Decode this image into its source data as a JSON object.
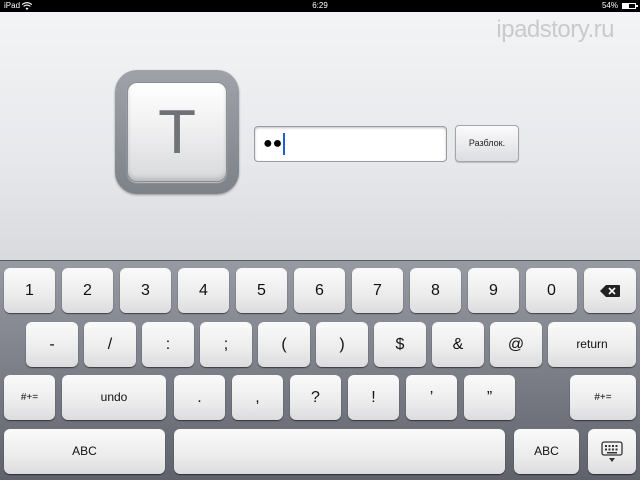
{
  "status_bar": {
    "carrier": "iPad",
    "time": "6:29",
    "battery_percent": "54%",
    "battery_level": 0.54
  },
  "watermark": "ipadstory.ru",
  "app_icon": {
    "letter": "T",
    "icon": "text-app-icon"
  },
  "password_field": {
    "value": "●●"
  },
  "unlock_button": {
    "label": "Разблок."
  },
  "keyboard": {
    "row1": [
      "1",
      "2",
      "3",
      "4",
      "5",
      "6",
      "7",
      "8",
      "9",
      "0"
    ],
    "backspace_icon": "backspace-icon",
    "row2": [
      "-",
      "/",
      ":",
      ";",
      "(",
      ")",
      "$",
      "&",
      "@"
    ],
    "return_label": "return",
    "row3_left_mode": "#+=",
    "undo_label": "undo",
    "row3": [
      ".",
      ",",
      "?",
      "!",
      "’",
      "”"
    ],
    "row3_right_mode": "#+=",
    "abc_left": "ABC",
    "abc_right": "ABC",
    "dismiss_icon": "keyboard-dismiss-icon"
  }
}
